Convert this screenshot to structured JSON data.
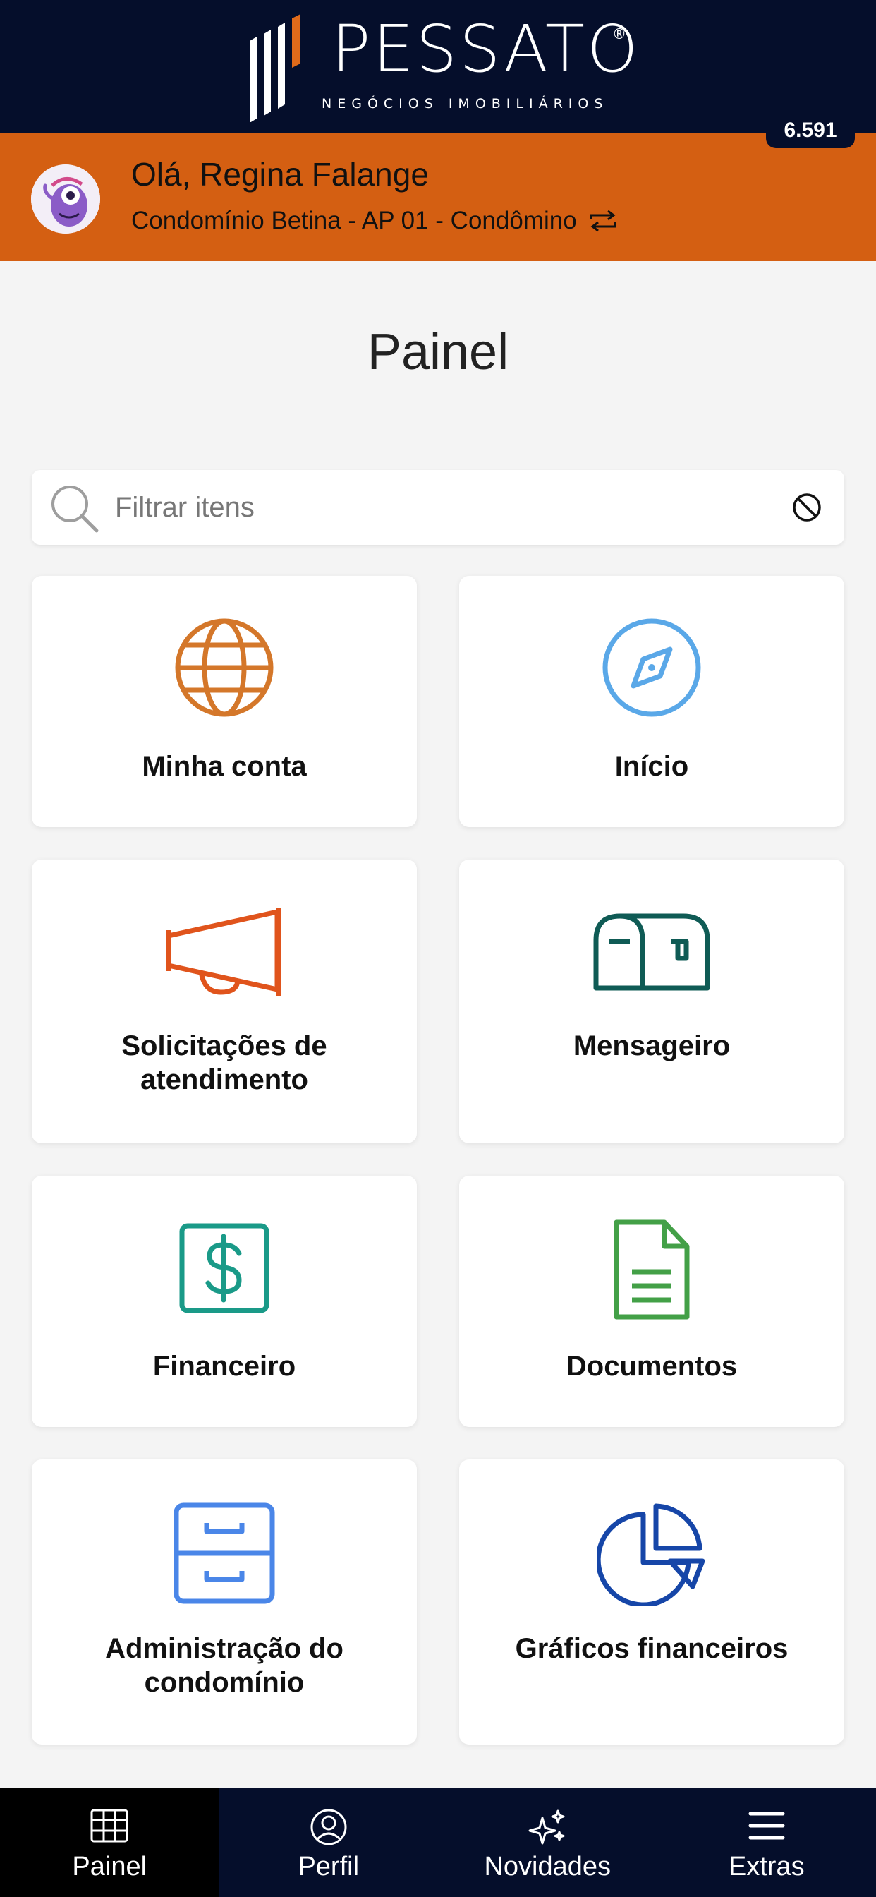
{
  "brand": {
    "name": "PESSATO",
    "registered": "®",
    "tagline": "NEGÓCIOS IMOBILIÁRIOS"
  },
  "user": {
    "greeting": "Olá, Regina Falange",
    "unit": "Condomínio Betina - AP 01 - Condômino",
    "counter": "6.591"
  },
  "page": {
    "title": "Painel"
  },
  "search": {
    "placeholder": "Filtrar itens"
  },
  "cards": [
    {
      "label": "Minha conta",
      "icon": "globe-icon",
      "color": "#d4772a"
    },
    {
      "label": "Início",
      "icon": "compass-icon",
      "color": "#5aa8e8"
    },
    {
      "label": "Solicitações de atendimento",
      "icon": "megaphone-icon",
      "color": "#e0541c"
    },
    {
      "label": "Mensageiro",
      "icon": "mailbox-icon",
      "color": "#0f5b55"
    },
    {
      "label": "Financeiro",
      "icon": "dollar-icon",
      "color": "#1a9a88"
    },
    {
      "label": "Documentos",
      "icon": "document-icon",
      "color": "#43a047"
    },
    {
      "label": "Administração do condomínio",
      "icon": "cabinet-icon",
      "color": "#4a86e8"
    },
    {
      "label": "Gráficos financeiros",
      "icon": "pie-chart-icon",
      "color": "#1646a8"
    }
  ],
  "nav": [
    {
      "label": "Painel",
      "icon": "grid-icon"
    },
    {
      "label": "Perfil",
      "icon": "user-circle-icon"
    },
    {
      "label": "Novidades",
      "icon": "sparkle-icon"
    },
    {
      "label": "Extras",
      "icon": "menu-icon"
    }
  ],
  "colors": {
    "brand_dark": "#050e2b",
    "accent_orange": "#d45f12"
  }
}
